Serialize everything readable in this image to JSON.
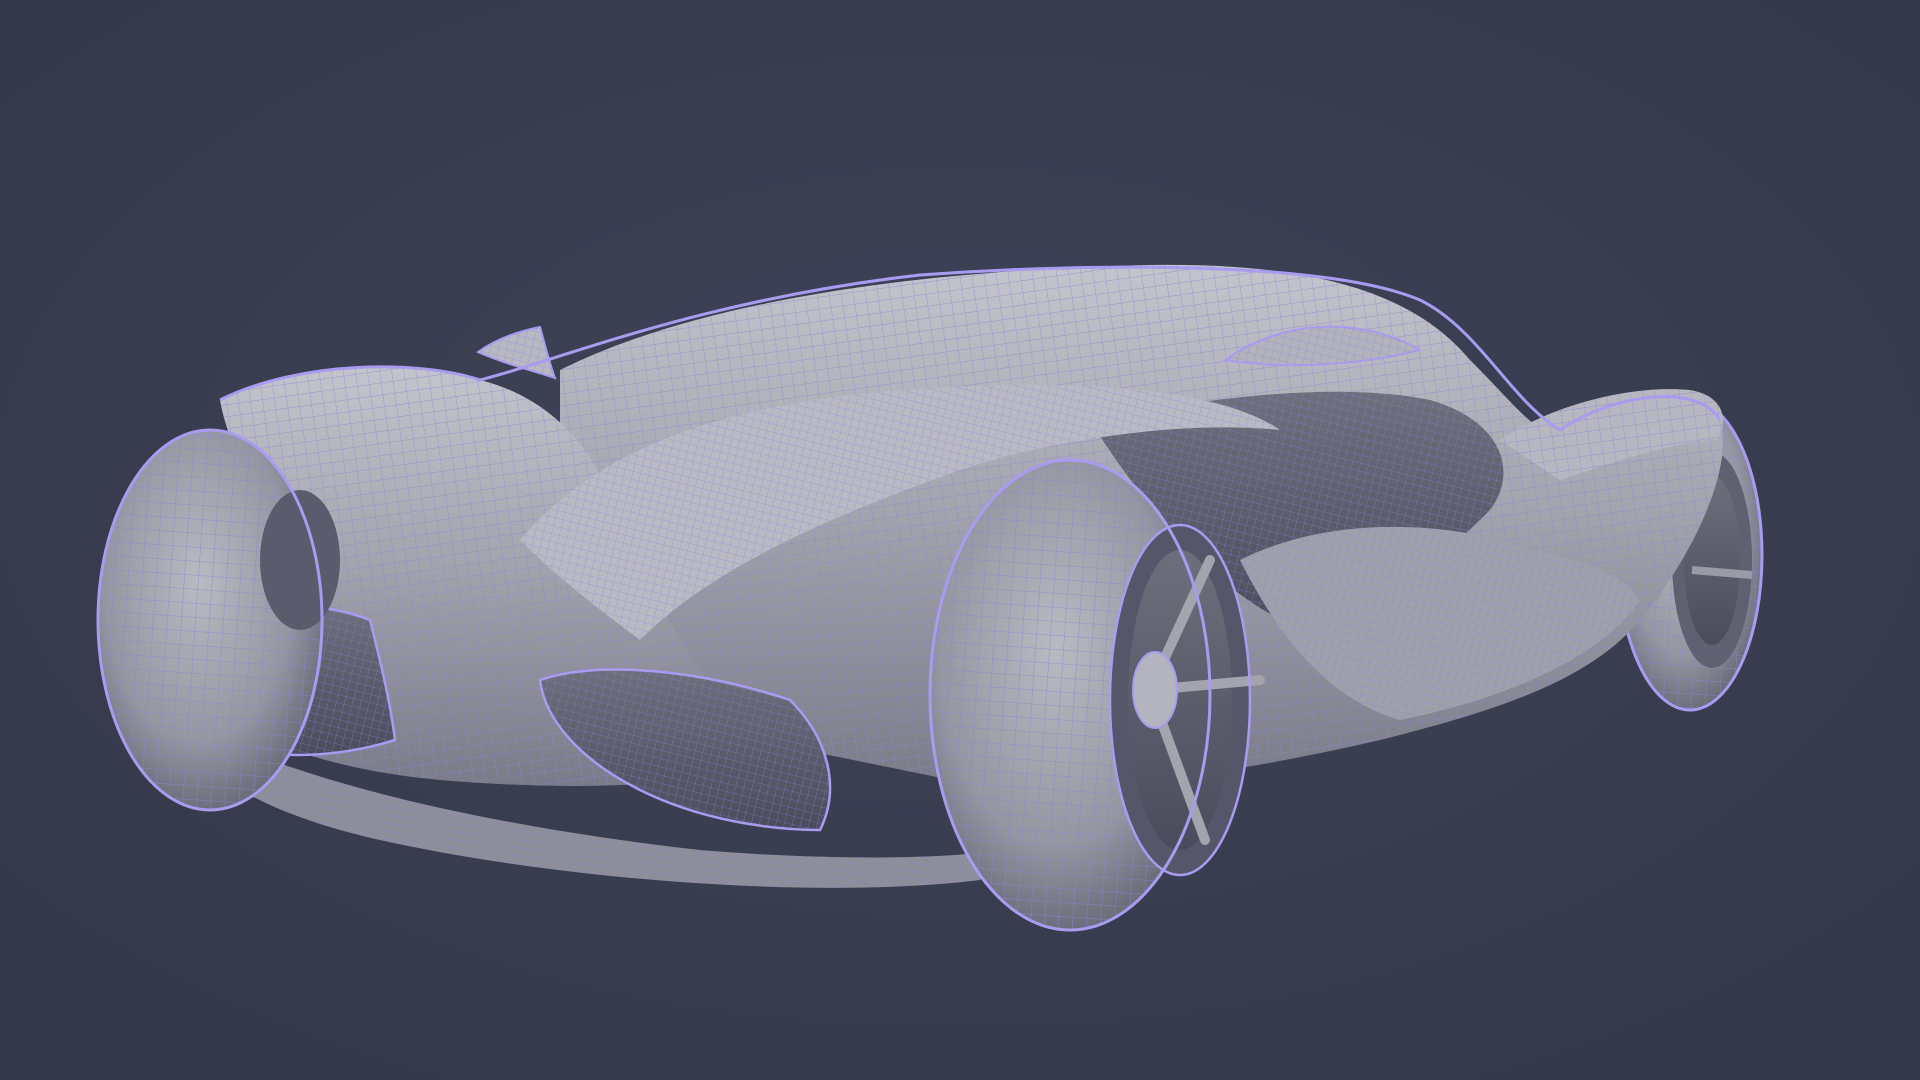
{
  "viewport": {
    "background_color": "#363a4e",
    "background_glow_color": "#3f4459",
    "subject": "wireframe-concept-car-model",
    "display_mode": "shaded-with-wireframe-overlay"
  },
  "model": {
    "surface_color": "#9c9da6",
    "surface_highlight_color": "#c3c4cc",
    "surface_shadow_color": "#55566a",
    "wire_color": "#8f82d6",
    "silhouette_color": "#a99cf0",
    "wheels": [
      {
        "name": "front-left-wheel"
      },
      {
        "name": "front-right-wheel"
      },
      {
        "name": "rear-right-wheel"
      }
    ]
  }
}
